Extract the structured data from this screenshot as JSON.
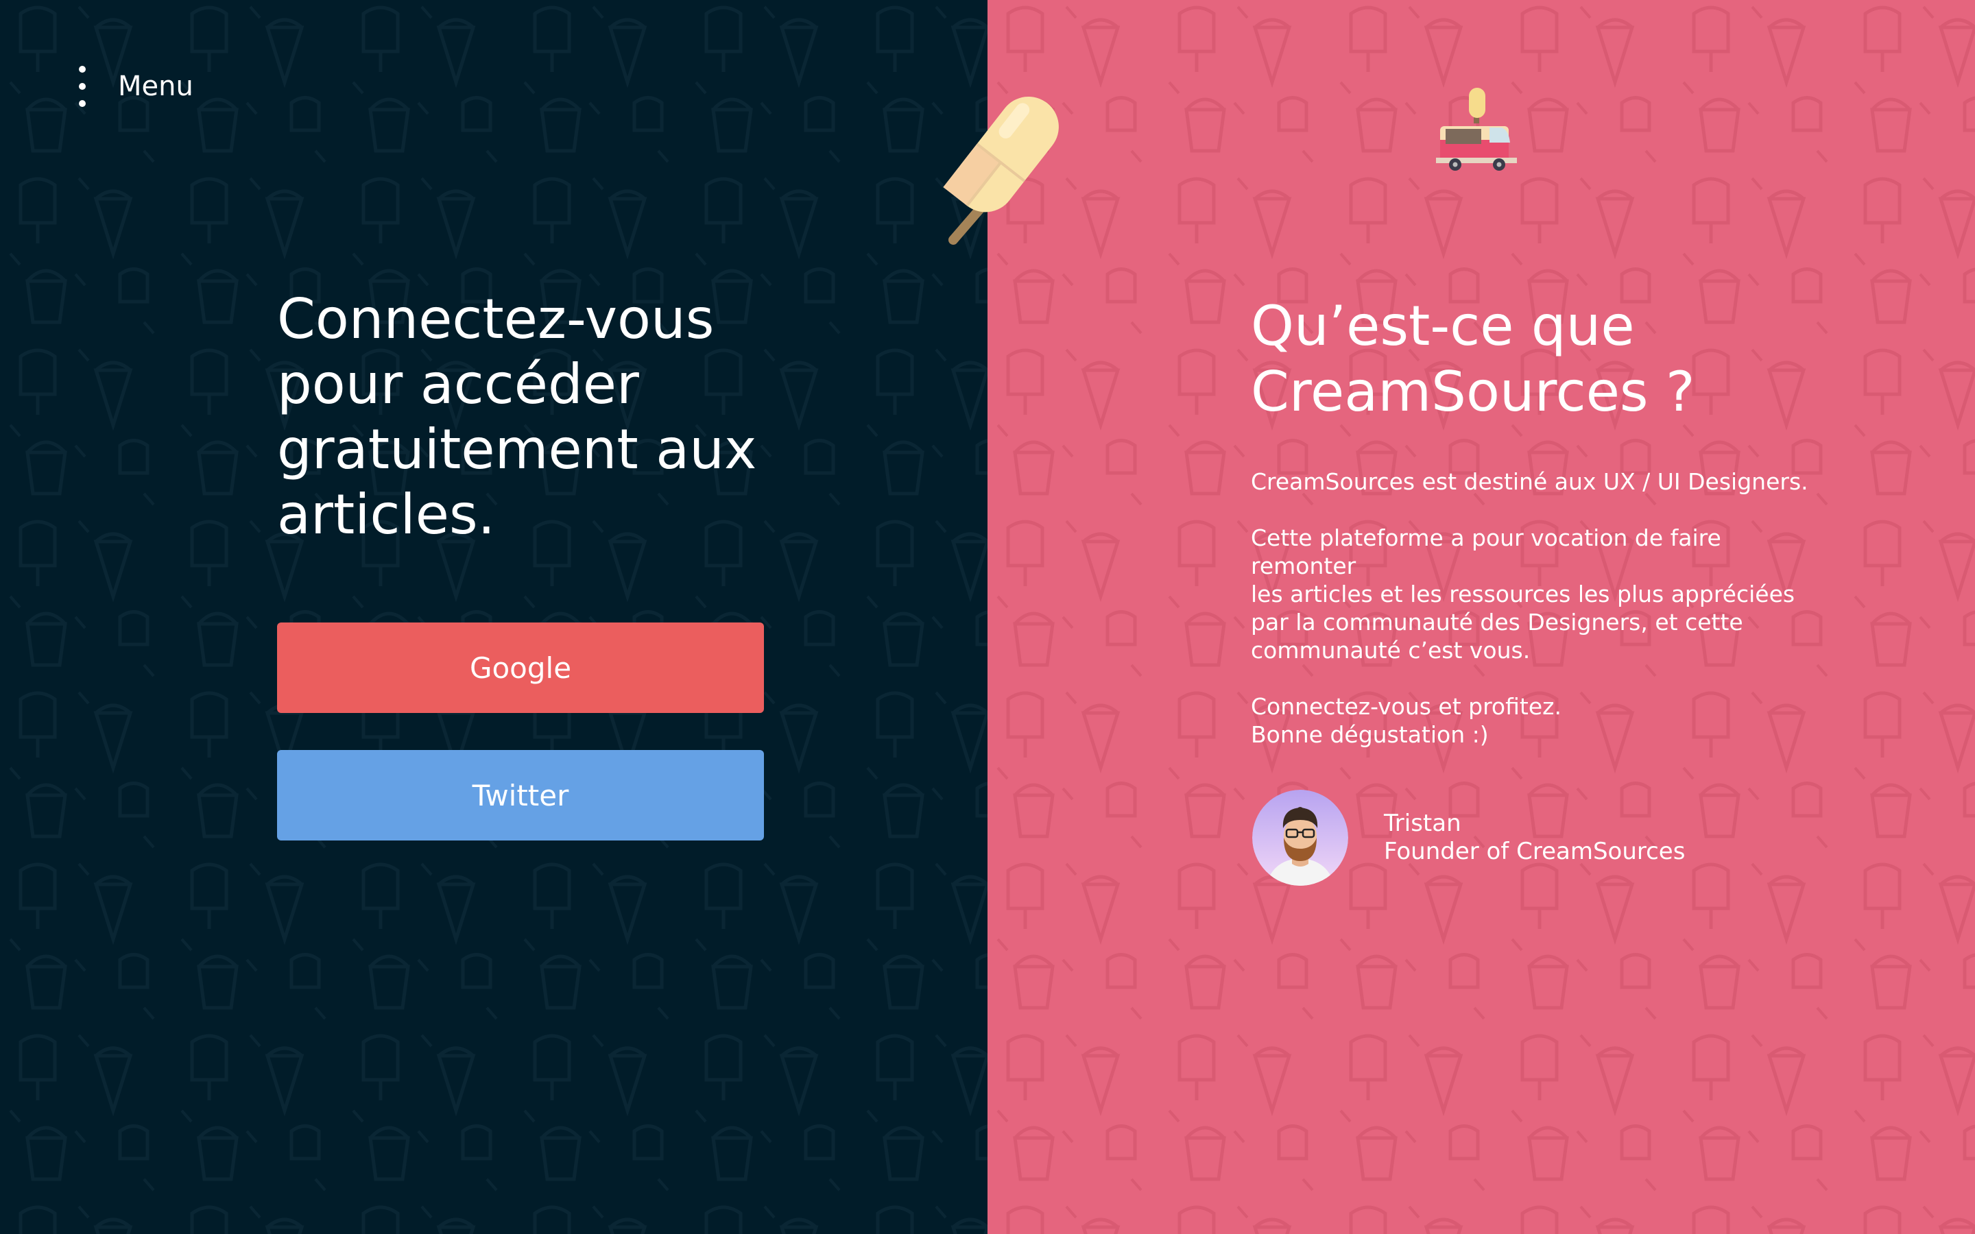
{
  "menu": {
    "label": "Menu"
  },
  "login": {
    "title_lines": [
      "Connectez-vous",
      "pour accéder",
      "gratuitement aux",
      "articles."
    ],
    "google_label": "Google",
    "twitter_label": "Twitter"
  },
  "about": {
    "title_lines": [
      "Qu’est-ce que",
      "CreamSources ?"
    ],
    "intro": "CreamSources est destiné aux UX / UI Designers.",
    "body_lines": [
      "Cette plateforme a pour vocation de faire remonter",
      "les articles et les ressources les plus appréciées",
      "par la communauté des Designers, et cette",
      "communauté c’est vous."
    ],
    "closing_lines": [
      "Connectez-vous et profitez.",
      "Bonne dégustation :)"
    ]
  },
  "author": {
    "name": "Tristan",
    "role": "Founder of CreamSources"
  },
  "colors": {
    "left_bg": "#011c29",
    "right_bg": "#e5657e",
    "google": "#eb5e5e",
    "twitter": "#65a1e5"
  },
  "icons": [
    "more-vertical-icon",
    "popsicle-icon",
    "ice-cream-truck-icon",
    "avatar-illustration"
  ]
}
